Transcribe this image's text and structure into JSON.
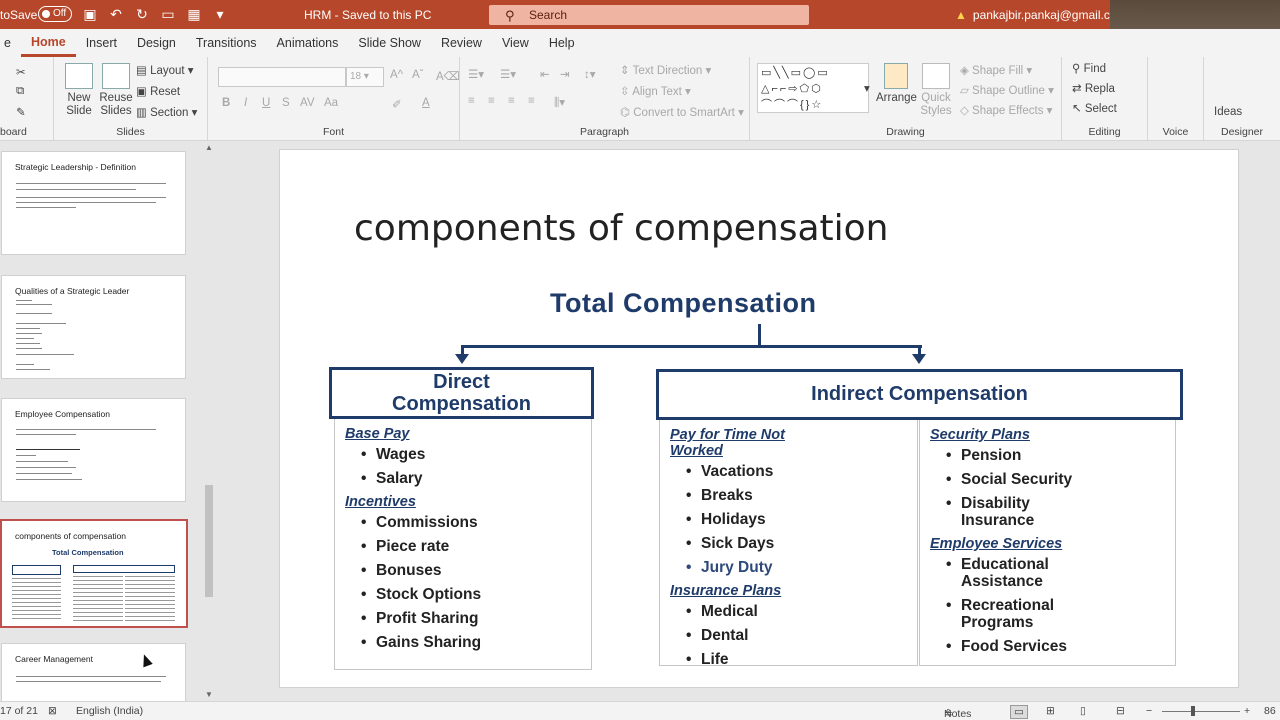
{
  "titlebar": {
    "autosave_label": "toSave",
    "autosave_state": "Off",
    "doc_title": "HRM  -  Saved to this PC",
    "search_placeholder": "Search",
    "account": "pankajbir.pankaj@gmail.com"
  },
  "tabs": [
    "e",
    "Home",
    "Insert",
    "Design",
    "Transitions",
    "Animations",
    "Slide Show",
    "Review",
    "View",
    "Help"
  ],
  "ribbon": {
    "clipboard": "board",
    "slides": {
      "name": "Slides",
      "new_slide": "New\nSlide",
      "reuse_slides": "Reuse\nSlides",
      "layout": "Layout",
      "reset": "Reset",
      "section": "Section"
    },
    "font": {
      "name": "Font",
      "size": "18",
      "bold": "B",
      "italic": "I",
      "underline": "U",
      "strike": "S",
      "aa": "Aa"
    },
    "paragraph": {
      "name": "Paragraph",
      "text_direction": "Text Direction",
      "align_text": "Align Text",
      "convert": "Convert to SmartArt"
    },
    "drawing": {
      "name": "Drawing",
      "arrange": "Arrange",
      "quick_styles": "Quick\nStyles",
      "shape_fill": "Shape Fill",
      "shape_outline": "Shape Outline",
      "shape_effects": "Shape Effects"
    },
    "editing": {
      "name": "Editing",
      "find": "Find",
      "replace": "Repla",
      "select": "Select"
    },
    "voice": "Voice",
    "designer": {
      "name": "Designer",
      "ideas": "Ideas"
    }
  },
  "thumbnails": [
    {
      "title": "Strategic Leadership - Definition"
    },
    {
      "title": "Qualities of a Strategic Leader"
    },
    {
      "title": "Employee Compensation"
    },
    {
      "title": "components of compensation",
      "active": true,
      "mini_title": "Total Compensation"
    },
    {
      "title": "Career Management"
    }
  ],
  "slide": {
    "title": "components of compensation",
    "diagram_title": "Total Compensation",
    "direct": {
      "heading": "Direct\nCompensation",
      "base_pay": "Base Pay",
      "base_items": [
        "Wages",
        "Salary"
      ],
      "incentives": "Incentives",
      "incentive_items": [
        "Commissions",
        "Piece rate",
        "Bonuses",
        "Stock Options",
        "Profit Sharing",
        "Gains Sharing"
      ]
    },
    "indirect": {
      "heading": "Indirect Compensation",
      "pay_not_worked": "Pay for Time Not\nWorked",
      "pay_items": [
        "Vacations",
        "Breaks",
        "Holidays",
        "Sick Days",
        "Jury Duty"
      ],
      "insurance": "Insurance Plans",
      "insurance_items": [
        "Medical",
        "Dental",
        "Life"
      ],
      "security": "Security Plans",
      "security_items": [
        "Pension",
        "Social Security",
        "Disability\nInsurance"
      ],
      "employee_services": "Employee Services",
      "service_items": [
        "Educational\nAssistance",
        "Recreational\nPrograms",
        "Food Services"
      ]
    }
  },
  "statusbar": {
    "slide_count": "17 of 21",
    "language": "English (India)",
    "notes": "Notes",
    "zoom": "86"
  }
}
